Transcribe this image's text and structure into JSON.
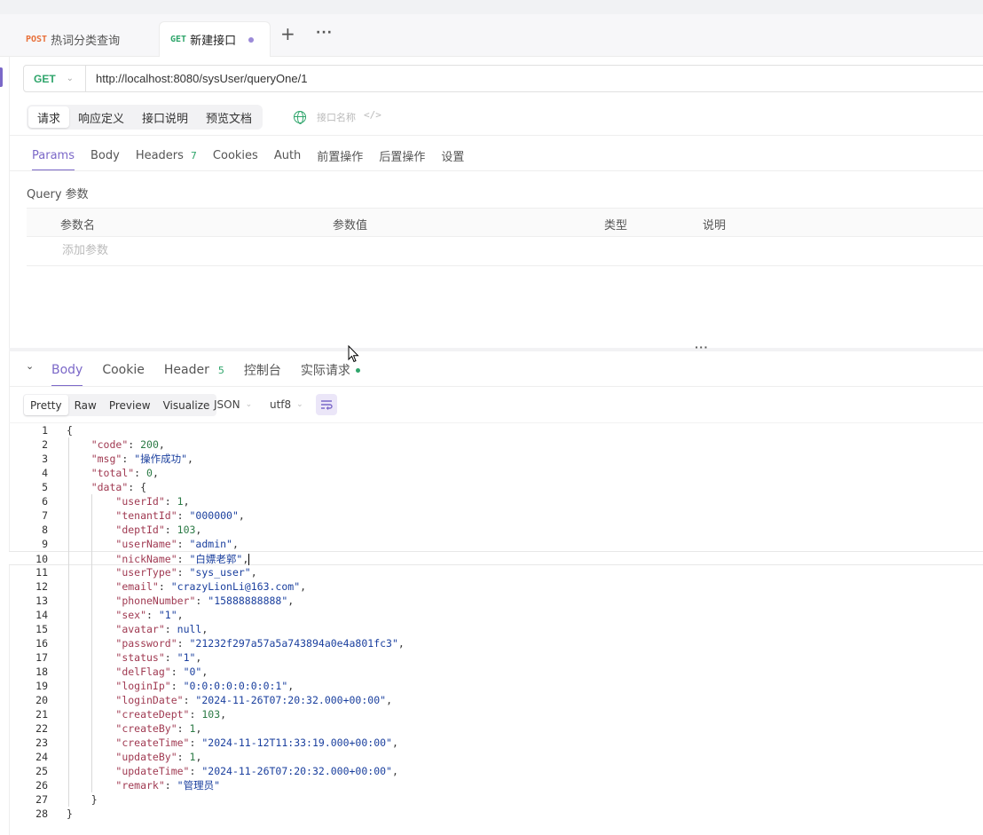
{
  "tabs": [
    {
      "method": "POST",
      "label": "热词分类查询"
    },
    {
      "method": "GET",
      "label": "新建接口"
    }
  ],
  "request": {
    "method": "GET",
    "url": "http://localhost:8080/sysUser/queryOne/1"
  },
  "segments": [
    "请求",
    "响应定义",
    "接口说明",
    "预览文档"
  ],
  "api_name_placeholder": "接口名称",
  "subtabs": [
    {
      "label": "Params",
      "badge": ""
    },
    {
      "label": "Body",
      "badge": ""
    },
    {
      "label": "Headers",
      "badge": "7"
    },
    {
      "label": "Cookies",
      "badge": ""
    },
    {
      "label": "Auth",
      "badge": ""
    },
    {
      "label": "前置操作",
      "badge": ""
    },
    {
      "label": "后置操作",
      "badge": ""
    },
    {
      "label": "设置",
      "badge": ""
    }
  ],
  "query": {
    "title": "Query 参数",
    "columns": [
      "参数名",
      "参数值",
      "类型",
      "说明"
    ],
    "add_placeholder": "添加参数"
  },
  "response": {
    "tabs": [
      {
        "label": "Body",
        "badge": ""
      },
      {
        "label": "Cookie",
        "badge": ""
      },
      {
        "label": "Header",
        "badge": "5"
      },
      {
        "label": "控制台",
        "badge": ""
      },
      {
        "label": "实际请求",
        "badge": ""
      }
    ],
    "view_modes": [
      "Pretty",
      "Raw",
      "Preview",
      "Visualize"
    ],
    "format": "JSON",
    "encoding": "utf8"
  },
  "body_json": {
    "code": 200,
    "msg": "操作成功",
    "total": 0,
    "data": [
      {
        "k": "userId",
        "v": "1",
        "t": "n"
      },
      {
        "k": "tenantId",
        "v": "000000",
        "t": "s"
      },
      {
        "k": "deptId",
        "v": "103",
        "t": "n"
      },
      {
        "k": "userName",
        "v": "admin",
        "t": "s"
      },
      {
        "k": "nickName",
        "v": "白嫖老郭",
        "t": "s"
      },
      {
        "k": "userType",
        "v": "sys_user",
        "t": "s"
      },
      {
        "k": "email",
        "v": "crazyLionLi@163.com",
        "t": "s"
      },
      {
        "k": "phoneNumber",
        "v": "15888888888",
        "t": "s"
      },
      {
        "k": "sex",
        "v": "1",
        "t": "s"
      },
      {
        "k": "avatar",
        "v": "null",
        "t": "kw"
      },
      {
        "k": "password",
        "v": "21232f297a57a5a743894a0e4a801fc3",
        "t": "s"
      },
      {
        "k": "status",
        "v": "1",
        "t": "s"
      },
      {
        "k": "delFlag",
        "v": "0",
        "t": "s"
      },
      {
        "k": "loginIp",
        "v": "0:0:0:0:0:0:0:1",
        "t": "s"
      },
      {
        "k": "loginDate",
        "v": "2024-11-26T07:20:32.000+00:00",
        "t": "s"
      },
      {
        "k": "createDept",
        "v": "103",
        "t": "n"
      },
      {
        "k": "createBy",
        "v": "1",
        "t": "n"
      },
      {
        "k": "createTime",
        "v": "2024-11-12T11:33:19.000+00:00",
        "t": "s"
      },
      {
        "k": "updateBy",
        "v": "1",
        "t": "n"
      },
      {
        "k": "updateTime",
        "v": "2024-11-26T07:20:32.000+00:00",
        "t": "s"
      },
      {
        "k": "remark",
        "v": "管理员",
        "t": "s"
      }
    ]
  },
  "cursor_line": 10,
  "colors": {
    "accent": "#7b68c8",
    "get": "#2fa56b",
    "post": "#e8703a"
  }
}
